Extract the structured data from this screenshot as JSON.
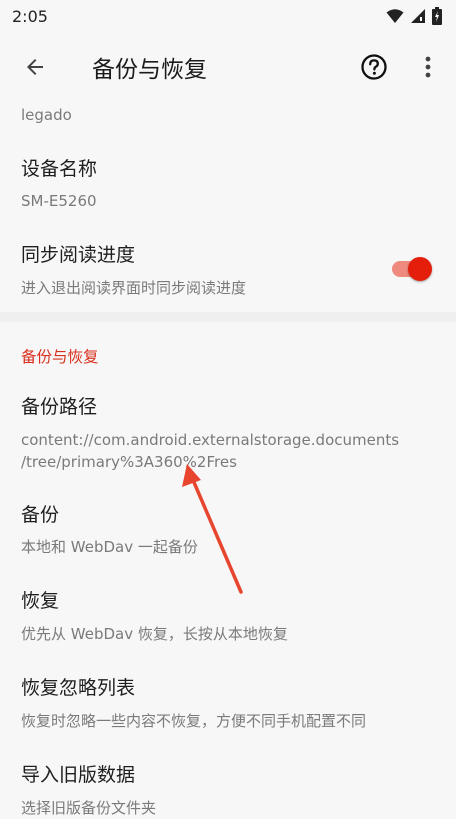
{
  "status_bar": {
    "time": "2:05"
  },
  "app_bar": {
    "title": "备份与恢复"
  },
  "prefs": {
    "top_summary": "legado",
    "device_name": {
      "title": "设备名称",
      "summary": "SM-E5260"
    },
    "sync_progress": {
      "title": "同步阅读进度",
      "summary": "进入退出阅读界面时同步阅读进度",
      "enabled": true
    }
  },
  "section": {
    "header": "备份与恢复"
  },
  "backup_prefs": {
    "backup_path": {
      "title": "备份路径",
      "summary_line1": "content://com.android.externalstorage.documents",
      "summary_line2": "/tree/primary%3A360%2Fres"
    },
    "backup": {
      "title": "备份",
      "summary": "本地和 WebDav 一起备份"
    },
    "restore": {
      "title": "恢复",
      "summary": "优先从 WebDav 恢复，长按从本地恢复"
    },
    "restore_ignore": {
      "title": "恢复忽略列表",
      "summary": "恢复时忽略一些内容不恢复，方便不同手机配置不同"
    },
    "import_old": {
      "title": "导入旧版数据",
      "summary": "选择旧版备份文件夹"
    }
  },
  "colors": {
    "accent": "#e51e0c",
    "section_header": "#d9301e",
    "annotation_arrow": "#e8452f"
  },
  "icons": [
    "wifi-icon",
    "signal-icon",
    "battery-icon",
    "back-arrow-icon",
    "help-circle-icon",
    "more-vert-icon"
  ]
}
